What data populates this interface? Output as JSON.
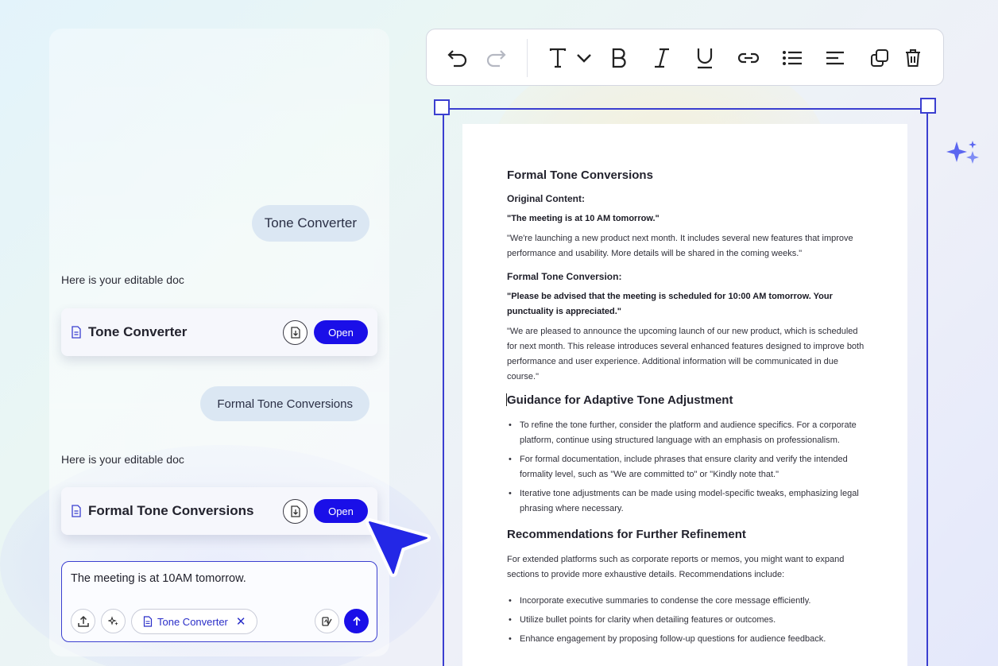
{
  "chat": {
    "user_messages": [
      "Tone Converter",
      "Formal Tone Conversions"
    ],
    "bot_replies": [
      "Here is your editable doc",
      "Here is your editable doc"
    ],
    "doc_cards": [
      {
        "title": "Tone Converter",
        "open_label": "Open"
      },
      {
        "title": "Formal Tone Conversions",
        "open_label": "Open"
      }
    ],
    "composer": {
      "input_text": "The meeting is at 10AM tomorrow.",
      "chip_label": "Tone Converter",
      "chip_close": "✕"
    }
  },
  "toolbar": {
    "icons": [
      "undo-icon",
      "redo-icon",
      "text-style-icon",
      "chevron-down-icon",
      "bold-icon",
      "italic-icon",
      "underline-icon",
      "link-icon",
      "bullet-list-icon",
      "align-icon",
      "duplicate-icon",
      "delete-icon"
    ]
  },
  "document": {
    "title": "Formal Tone Conversions",
    "original_label": "Original Content:",
    "original_quote": "\"The meeting is at 10 AM tomorrow.\"",
    "original_para": "\"We're launching a new product next month. It includes several new features that improve performance and usability. More details will be shared in the coming weeks.\"",
    "formal_label": "Formal Tone Conversion:",
    "formal_quote": "\"Please be advised that the meeting is scheduled for 10:00 AM tomorrow. Your punctuality is appreciated.\"",
    "formal_para": "\"We are pleased to announce the upcoming launch of our new product, which is scheduled for next month. This release introduces several enhanced features designed to improve both performance and user experience. Additional information will be communicated in due course.\"",
    "guidance_heading": "Guidance for Adaptive Tone Adjustment",
    "guidance_items": [
      "To refine the tone further, consider the platform and audience specifics. For a corporate platform, continue using structured language with an emphasis on professionalism.",
      "For formal documentation, include phrases that ensure clarity and verify the intended formality level, such as \"We are committed to\" or \"Kindly note that.\"",
      "Iterative tone adjustments can be made using model-specific tweaks, emphasizing legal phrasing where necessary."
    ],
    "recommend_heading": "Recommendations for Further Refinement",
    "recommend_para": "For extended platforms such as corporate reports or memos, you might want to expand sections to provide more exhaustive details. Recommendations include:",
    "recommend_items": [
      "Incorporate executive summaries to condense the core message efficiently.",
      "Utilize bullet points for clarity when detailing features or outcomes.",
      "Enhance engagement by proposing follow-up questions for audience feedback."
    ]
  },
  "colors": {
    "accent": "#1a0fe8",
    "frame": "#3b3fd0",
    "bubble": "#dbe7f3"
  }
}
